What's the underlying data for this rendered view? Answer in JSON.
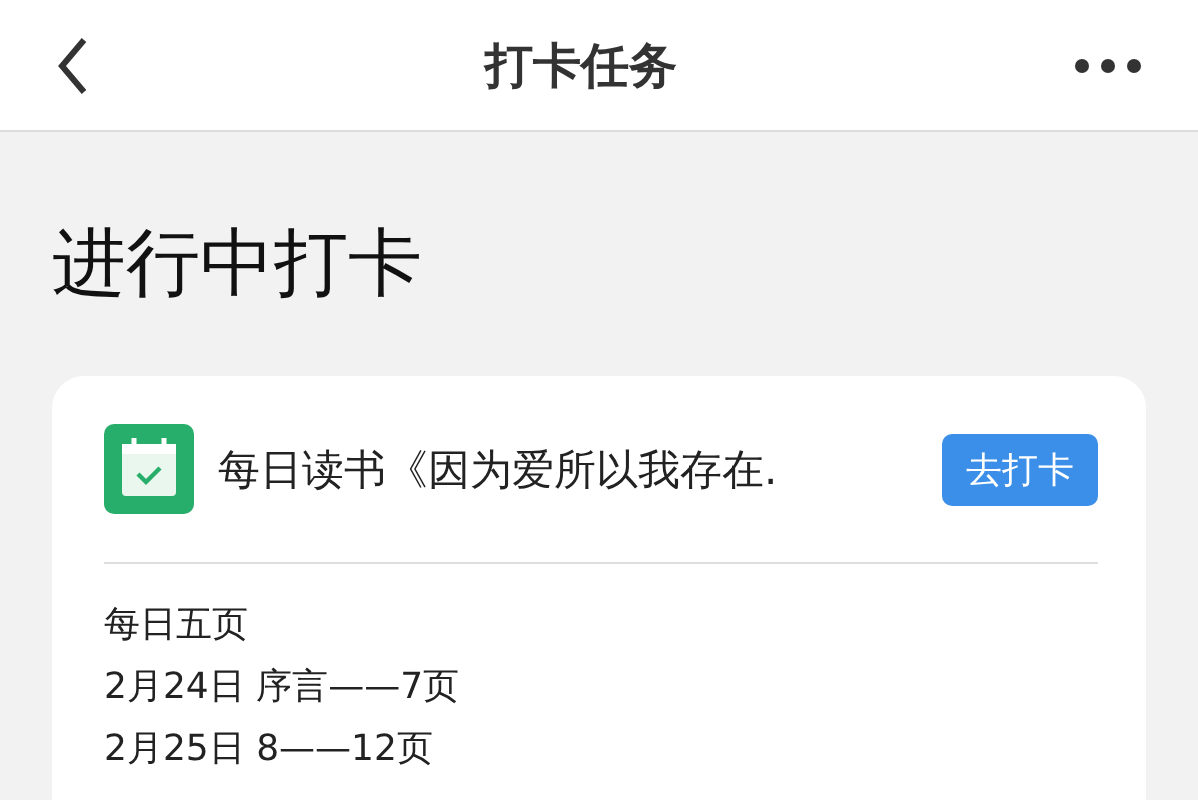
{
  "nav_bar": {
    "title": "打卡任务"
  },
  "section_title": "进行中打卡",
  "task_card": {
    "title": "每日读书《因为爱所以我存在.",
    "action": "去打卡",
    "lines": [
      "每日五页",
      "2月24日  序言——7页",
      "2月25日  8——12页"
    ]
  }
}
